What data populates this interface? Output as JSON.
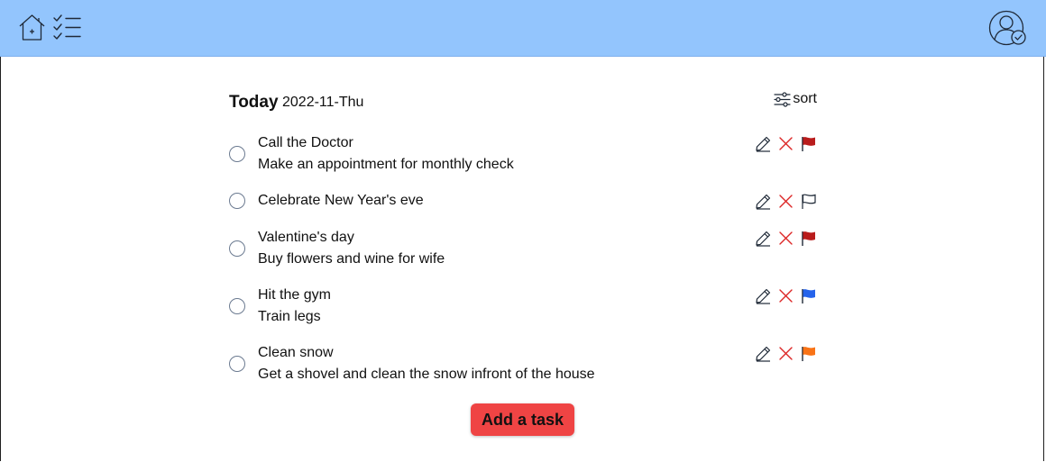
{
  "header": {
    "home_icon": "home-add-icon",
    "tasks_icon": "checklist-icon",
    "profile_icon": "user-check-icon",
    "background": "#93c5fd"
  },
  "main": {
    "heading": "Today",
    "date": "2022-11-Thu",
    "sort_label": "sort"
  },
  "tasks": [
    {
      "title": "Call the Doctor",
      "description": "Make an appointment for monthly check",
      "flag": "red",
      "completed": false
    },
    {
      "title": "Celebrate New Year's eve",
      "description": "",
      "flag": "none",
      "completed": false
    },
    {
      "title": "Valentine's day",
      "description": "Buy flowers and wine for wife",
      "flag": "red",
      "completed": false
    },
    {
      "title": "Hit the gym",
      "description": "Train legs",
      "flag": "blue",
      "completed": false
    },
    {
      "title": "Clean snow",
      "description": "Get a shovel and clean the snow infront of the house",
      "flag": "orange",
      "completed": false
    }
  ],
  "flag_colors": {
    "red": "#b91c1c",
    "blue": "#2563eb",
    "orange": "#f97316"
  },
  "add_button": {
    "label": "Add a task",
    "color": "#ef4444"
  }
}
